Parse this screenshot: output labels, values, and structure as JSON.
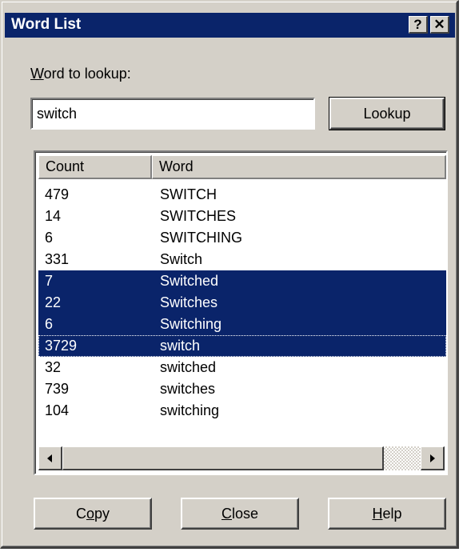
{
  "window": {
    "title": "Word List",
    "help_glyph": "?",
    "close_glyph": "✕"
  },
  "lookup": {
    "label_accel": "W",
    "label_rest": "ord to lookup:",
    "value": "switch",
    "button_label": "Lookup"
  },
  "list": {
    "columns": [
      "Count",
      "Word"
    ],
    "rows": [
      {
        "count": "479",
        "word": "SWITCH",
        "selected": false
      },
      {
        "count": "14",
        "word": "SWITCHES",
        "selected": false
      },
      {
        "count": "6",
        "word": "SWITCHING",
        "selected": false
      },
      {
        "count": "331",
        "word": "Switch",
        "selected": false
      },
      {
        "count": "7",
        "word": "Switched",
        "selected": true
      },
      {
        "count": "22",
        "word": "Switches",
        "selected": true
      },
      {
        "count": "6",
        "word": "Switching",
        "selected": true
      },
      {
        "count": "3729",
        "word": "switch",
        "selected": true,
        "focused": true
      },
      {
        "count": "32",
        "word": "switched",
        "selected": false
      },
      {
        "count": "739",
        "word": "switches",
        "selected": false
      },
      {
        "count": "104",
        "word": "switching",
        "selected": false
      }
    ]
  },
  "buttons": {
    "copy": {
      "accel": "o",
      "pre": "C",
      "post": "py"
    },
    "close": {
      "accel": "C",
      "pre": "",
      "post": "lose"
    },
    "help": {
      "accel": "H",
      "pre": "",
      "post": "elp"
    }
  },
  "colors": {
    "title_bar": "#0a246a",
    "selection": "#0a246a",
    "face": "#d4d0c8"
  }
}
